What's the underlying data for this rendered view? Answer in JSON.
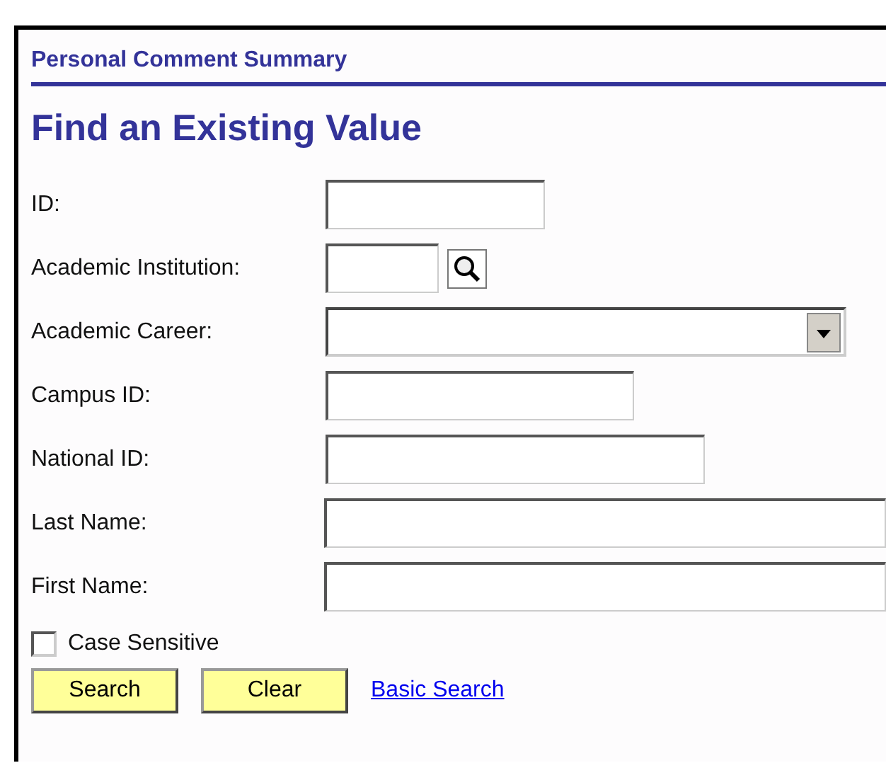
{
  "page_title": "Personal Comment Summary",
  "heading": "Find an Existing Value",
  "fields": [
    {
      "label": "ID:",
      "kind": "text"
    },
    {
      "label": "Academic Institution:",
      "kind": "lookup"
    },
    {
      "label": "Academic Career:",
      "kind": "select"
    },
    {
      "label": "Campus ID:",
      "kind": "text"
    },
    {
      "label": "National ID:",
      "kind": "text"
    },
    {
      "label": "Last Name:",
      "kind": "text"
    },
    {
      "label": "First Name:",
      "kind": "text"
    }
  ],
  "case_sensitive": {
    "label": "Case Sensitive",
    "checked": false
  },
  "buttons": [
    "Search",
    "Clear"
  ],
  "link": "Basic Search"
}
